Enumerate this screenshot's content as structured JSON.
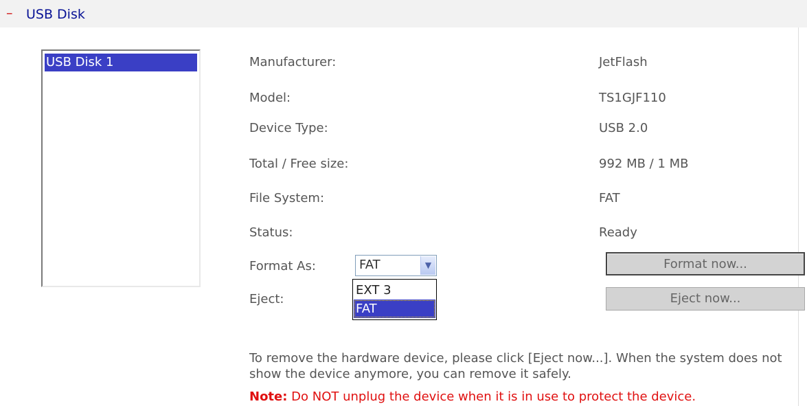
{
  "section": {
    "title": "USB Disk",
    "collapse_symbol": "–",
    "collapse_icon": "collapse-minus-icon"
  },
  "disk_list": {
    "items": [
      "USB Disk 1"
    ],
    "selected_index": 0
  },
  "details": [
    {
      "label": "Manufacturer:",
      "value": "JetFlash"
    },
    {
      "label": "Model:",
      "value": "TS1GJF110"
    },
    {
      "label": "Device Type:",
      "value": "USB 2.0"
    },
    {
      "label": "Total / Free size:",
      "value": "992 MB / 1 MB"
    },
    {
      "label": "File System:",
      "value": "FAT"
    },
    {
      "label": "Status:",
      "value": "Ready"
    }
  ],
  "format": {
    "label": "Format As:",
    "selected": "FAT",
    "options": [
      "EXT 3",
      "FAT"
    ],
    "highlighted_option": "FAT",
    "button_label": "Format now..."
  },
  "eject": {
    "label": "Eject:",
    "button_label": "Eject now..."
  },
  "info_text": "To remove the hardware device, please click [Eject now...]. When the system does not show the device anymore, you can remove it safely.",
  "note": {
    "prefix": "Note:",
    "text": " Do NOT unplug the device when it is in use to protect the device."
  },
  "colors": {
    "selection": "#3a3fc5",
    "title": "#0a1496",
    "note": "#e01010",
    "collapse": "#d01010"
  }
}
